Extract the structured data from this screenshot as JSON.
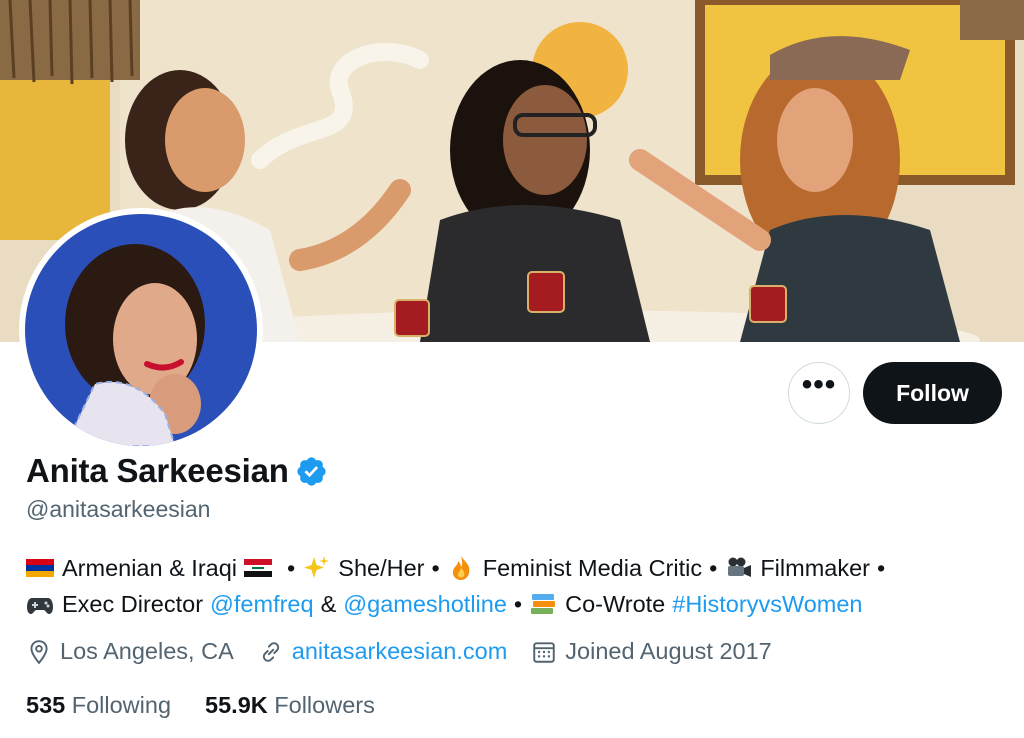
{
  "profile": {
    "display_name": "Anita Sarkeesian",
    "handle": "@anitasarkeesian",
    "verified": true
  },
  "actions": {
    "more_label": "•••",
    "follow_label": "Follow"
  },
  "bio": {
    "line1": {
      "armenian_flag_icon": "armenian-flag",
      "armenian_iraqi": "Armenian & Iraqi",
      "iraqi_flag_icon": "iraqi-flag",
      "sep1": "•",
      "sparkles_icon": "sparkles",
      "pronouns": "She/Her",
      "sep2": "•",
      "fire_icon": "fire",
      "critic": "Feminist Media Critic",
      "sep3": "•",
      "camera_icon": "movie-camera",
      "filmmaker": "Filmmaker",
      "sep4": "•"
    },
    "line2": {
      "gamepad_icon": "game-controller",
      "exec": "Exec Director",
      "femfreq": "@femfreq",
      "amp": "&",
      "gameshotline": "@gameshotline",
      "sep5": "•",
      "books_icon": "books",
      "cowrote": "Co-Wrote",
      "hashtag": "#HistoryvsWomen"
    }
  },
  "meta": {
    "location": "Los Angeles, CA",
    "website": "anitasarkeesian.com",
    "joined": "Joined August 2017"
  },
  "stats": {
    "following_count": "535",
    "following_label": "Following",
    "followers_count": "55.9K",
    "followers_label": "Followers"
  },
  "colors": {
    "accent": "#1d9bf0",
    "text": "#0f1419",
    "muted": "#536471",
    "button_dark": "#0f1419"
  }
}
